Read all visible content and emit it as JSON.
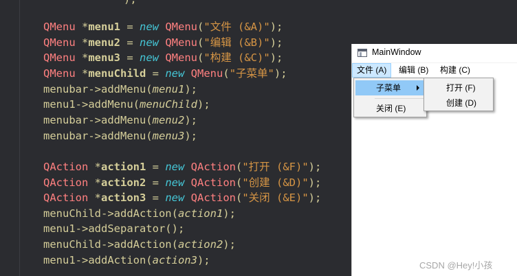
{
  "editor": {
    "top_cut": ");",
    "lines": [
      [
        [
          "tok-type",
          "QMenu "
        ],
        [
          "tok-op",
          "*"
        ],
        [
          "tok-bold",
          "menu1"
        ],
        [
          "tok-op",
          " = "
        ],
        [
          "tok-kw",
          "new"
        ],
        [
          "tok-type",
          " QMenu"
        ],
        [
          "tok-op",
          "("
        ],
        [
          "tok-str",
          "\"文件 (&A)\""
        ],
        [
          "tok-op",
          ");"
        ]
      ],
      [
        [
          "tok-type",
          "QMenu "
        ],
        [
          "tok-op",
          "*"
        ],
        [
          "tok-bold",
          "menu2"
        ],
        [
          "tok-op",
          " = "
        ],
        [
          "tok-kw",
          "new"
        ],
        [
          "tok-type",
          " QMenu"
        ],
        [
          "tok-op",
          "("
        ],
        [
          "tok-str",
          "\"编辑 (&B)\""
        ],
        [
          "tok-op",
          ");"
        ]
      ],
      [
        [
          "tok-type",
          "QMenu "
        ],
        [
          "tok-op",
          "*"
        ],
        [
          "tok-bold",
          "menu3"
        ],
        [
          "tok-op",
          " = "
        ],
        [
          "tok-kw",
          "new"
        ],
        [
          "tok-type",
          " QMenu"
        ],
        [
          "tok-op",
          "("
        ],
        [
          "tok-str",
          "\"构建 (&C)\""
        ],
        [
          "tok-op",
          ");"
        ]
      ],
      [
        [
          "tok-type",
          "QMenu "
        ],
        [
          "tok-op",
          "*"
        ],
        [
          "tok-bold",
          "menuChild"
        ],
        [
          "tok-op",
          " = "
        ],
        [
          "tok-kw",
          "new"
        ],
        [
          "tok-type",
          " QMenu"
        ],
        [
          "tok-op",
          "("
        ],
        [
          "tok-str",
          "\"子菜单\""
        ],
        [
          "tok-op",
          ");"
        ]
      ],
      [
        [
          "tok-fn",
          "menubar->addMenu("
        ],
        [
          "tok-param",
          "menu1"
        ],
        [
          "tok-op",
          ");"
        ]
      ],
      [
        [
          "tok-fn",
          "menu1->addMenu("
        ],
        [
          "tok-param",
          "menuChild"
        ],
        [
          "tok-op",
          ");"
        ]
      ],
      [
        [
          "tok-fn",
          "menubar->addMenu("
        ],
        [
          "tok-param",
          "menu2"
        ],
        [
          "tok-op",
          ");"
        ]
      ],
      [
        [
          "tok-fn",
          "menubar->addMenu("
        ],
        [
          "tok-param",
          "menu3"
        ],
        [
          "tok-op",
          ");"
        ]
      ],
      [],
      [
        [
          "tok-type",
          "QAction "
        ],
        [
          "tok-op",
          "*"
        ],
        [
          "tok-bold",
          "action1"
        ],
        [
          "tok-op",
          " = "
        ],
        [
          "tok-kw",
          "new"
        ],
        [
          "tok-type",
          " QAction"
        ],
        [
          "tok-op",
          "("
        ],
        [
          "tok-str",
          "\"打开 (&F)\""
        ],
        [
          "tok-op",
          ");"
        ]
      ],
      [
        [
          "tok-type",
          "QAction "
        ],
        [
          "tok-op",
          "*"
        ],
        [
          "tok-bold",
          "action2"
        ],
        [
          "tok-op",
          " = "
        ],
        [
          "tok-kw",
          "new"
        ],
        [
          "tok-type",
          " QAction"
        ],
        [
          "tok-op",
          "("
        ],
        [
          "tok-str",
          "\"创建 (&D)\""
        ],
        [
          "tok-op",
          ");"
        ]
      ],
      [
        [
          "tok-type",
          "QAction "
        ],
        [
          "tok-op",
          "*"
        ],
        [
          "tok-bold",
          "action3"
        ],
        [
          "tok-op",
          " = "
        ],
        [
          "tok-kw",
          "new"
        ],
        [
          "tok-type",
          " QAction"
        ],
        [
          "tok-op",
          "("
        ],
        [
          "tok-str",
          "\"关闭 (&E)\""
        ],
        [
          "tok-op",
          ");"
        ]
      ],
      [
        [
          "tok-fn",
          "menuChild->addAction("
        ],
        [
          "tok-param",
          "action1"
        ],
        [
          "tok-op",
          ");"
        ]
      ],
      [
        [
          "tok-fn",
          "menu1->addSeparator();"
        ]
      ],
      [
        [
          "tok-fn",
          "menuChild->addAction("
        ],
        [
          "tok-param",
          "action2"
        ],
        [
          "tok-op",
          ");"
        ]
      ],
      [
        [
          "tok-fn",
          "menu1->addAction("
        ],
        [
          "tok-param",
          "action3"
        ],
        [
          "tok-op",
          ");"
        ]
      ]
    ]
  },
  "window": {
    "title": "MainWindow",
    "menubar": [
      "文件 (A)",
      "编辑 (B)",
      "构建 (C)"
    ],
    "file_menu": {
      "submenu_label": "子菜单",
      "close_label": "关闭 (E)"
    },
    "child_menu": {
      "open_label": "打开 (F)",
      "create_label": "创建 (D)"
    }
  },
  "watermark": "CSDN @Hey!小孩"
}
